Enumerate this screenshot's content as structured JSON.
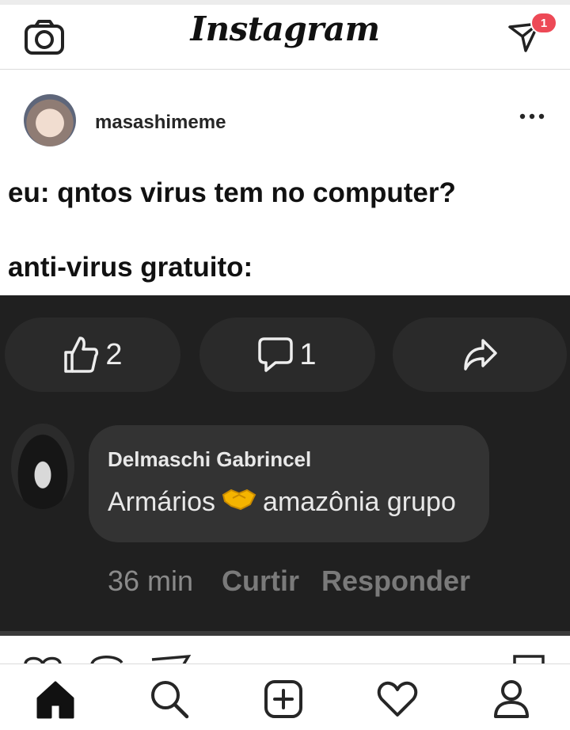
{
  "app": {
    "title": "Instagram",
    "notification_count": "1",
    "colors": {
      "badge": "#ed4956",
      "dark_panel": "#202020",
      "bubble": "#333333"
    }
  },
  "header_icons": [
    "camera-icon",
    "direct-message-icon"
  ],
  "post": {
    "username": "masashimeme",
    "meme_line_1": "eu: qntos virus tem no computer?",
    "meme_line_2": "anti-virus gratuito:",
    "actions": {
      "like_count": "2",
      "comment_count": "1"
    },
    "comment": {
      "author": "Delmaschi Gabrincel",
      "text_before": "Armários",
      "text_after": "amazônia grupo",
      "emoji": "handshake-emoji",
      "time": "36 min",
      "like_label": "Curtir",
      "reply_label": "Responder"
    }
  },
  "tab_bar": [
    "home-icon",
    "search-icon",
    "new-post-icon",
    "activity-icon",
    "profile-icon"
  ]
}
